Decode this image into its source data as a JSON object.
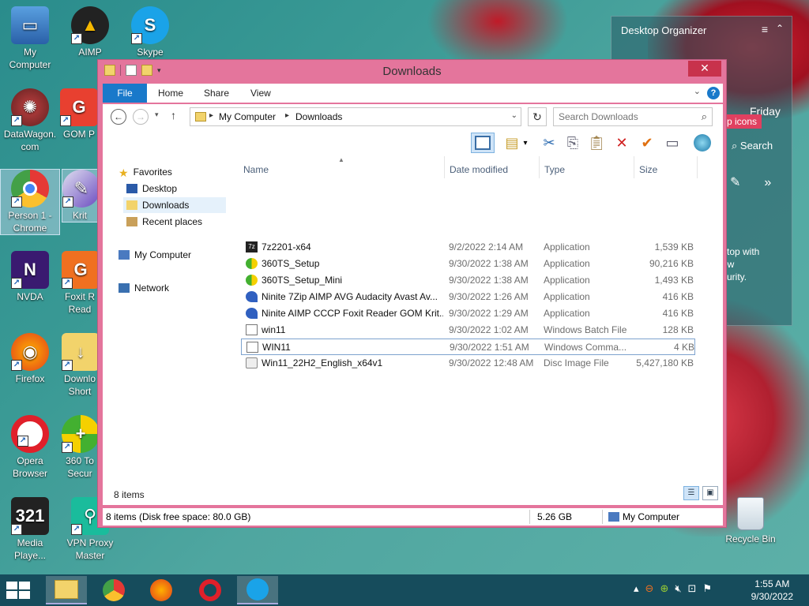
{
  "desktop": {
    "icons": [
      {
        "label": "My\nComputer"
      },
      {
        "label": "AIMP"
      },
      {
        "label": "Skype"
      },
      {
        "label": "DataWagon.\ncom"
      },
      {
        "label": "GOM P"
      },
      {
        "label": "Person 1 -\nChrome"
      },
      {
        "label": "Krit"
      },
      {
        "label": "NVDA"
      },
      {
        "label": "Foxit R\nRead"
      },
      {
        "label": "Firefox"
      },
      {
        "label": "Downlo\nShort"
      },
      {
        "label": "Opera\nBrowser"
      },
      {
        "label": "360 To\nSecur"
      },
      {
        "label": "Media\nPlaye..."
      },
      {
        "label": "VPN Proxy\nMaster"
      }
    ],
    "recycle_bin": "Recycle Bin"
  },
  "organizer": {
    "title": "Desktop Organizer",
    "day": "Friday",
    "badge": "p icons",
    "search": "Search",
    "text": "ktop with\new\ncurity."
  },
  "window": {
    "title": "Downloads",
    "ribbon_tabs": [
      "File",
      "Home",
      "Share",
      "View"
    ],
    "breadcrumb": [
      "My Computer",
      "Downloads"
    ],
    "search_placeholder": "Search Downloads",
    "nav": {
      "favorites": "Favorites",
      "desktop": "Desktop",
      "downloads": "Downloads",
      "recent": "Recent places",
      "computer": "My Computer",
      "network": "Network"
    },
    "columns": {
      "name": "Name",
      "date": "Date modified",
      "type": "Type",
      "size": "Size"
    },
    "files": [
      {
        "name": "7z2201-x64",
        "date": "9/2/2022 2:14 AM",
        "type": "Application",
        "size": "1,539 KB"
      },
      {
        "name": "360TS_Setup",
        "date": "9/30/2022 1:38 AM",
        "type": "Application",
        "size": "90,216 KB"
      },
      {
        "name": "360TS_Setup_Mini",
        "date": "9/30/2022 1:38 AM",
        "type": "Application",
        "size": "1,493 KB"
      },
      {
        "name": "Ninite 7Zip AIMP AVG Audacity Avast Av...",
        "date": "9/30/2022 1:26 AM",
        "type": "Application",
        "size": "416 KB"
      },
      {
        "name": "Ninite AIMP CCCP Foxit Reader GOM Krit...",
        "date": "9/30/2022 1:29 AM",
        "type": "Application",
        "size": "416 KB"
      },
      {
        "name": "win11",
        "date": "9/30/2022 1:02 AM",
        "type": "Windows Batch File",
        "size": "128 KB"
      },
      {
        "name": "WIN11",
        "date": "9/30/2022 1:51 AM",
        "type": "Windows Comma...",
        "size": "4 KB"
      },
      {
        "name": "Win11_22H2_English_x64v1",
        "date": "9/30/2022 12:48 AM",
        "type": "Disc Image File",
        "size": "5,427,180 KB"
      }
    ],
    "item_count": "8 items",
    "status": {
      "left": "8 items (Disk free space: 80.0 GB)",
      "size": "5.26 GB",
      "location": "My Computer"
    }
  },
  "taskbar": {
    "time": "1:55 AM",
    "date": "9/30/2022"
  },
  "colors": {
    "window_frame": "#e4759c",
    "accent": "#1979ca",
    "taskbar": "#164c5c"
  }
}
